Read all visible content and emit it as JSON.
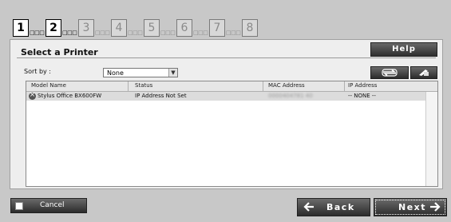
{
  "steps": [
    {
      "num": "1",
      "active": true
    },
    {
      "num": "2",
      "active": true
    },
    {
      "num": "3",
      "active": false
    },
    {
      "num": "4",
      "active": false
    },
    {
      "num": "5",
      "active": false
    },
    {
      "num": "6",
      "active": false
    },
    {
      "num": "7",
      "active": false
    },
    {
      "num": "8",
      "active": false
    }
  ],
  "step_dots": "□□□",
  "panel": {
    "title": "Select a Printer",
    "help_label": "Help",
    "sort_label": "Sort by :",
    "sort_value": "None",
    "sort_arrow": "▼",
    "refresh_icon": "refresh-icon",
    "manual_icon": "pencil-icon"
  },
  "table": {
    "columns": [
      "Model Name",
      "Status",
      "MAC Address",
      "IP Address"
    ],
    "rows": [
      {
        "model": "Stylus Office BX600FW",
        "status": "IP Address Not Set",
        "mac": "0000404781 40",
        "ip": "-- NONE --",
        "icon": "error-icon"
      }
    ]
  },
  "footer": {
    "cancel_label": "Cancel",
    "back_label": "Back",
    "next_label": "Next"
  }
}
